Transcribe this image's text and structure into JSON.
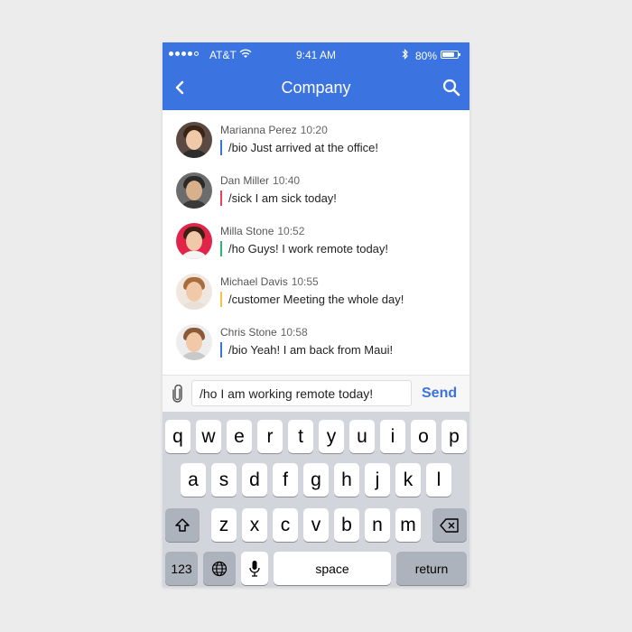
{
  "status_bar": {
    "carrier": "AT&T",
    "time": "9:41 AM",
    "battery": "80%"
  },
  "header": {
    "title": "Company",
    "back_icon": "chevron-left-icon",
    "search_icon": "search-icon"
  },
  "messages": [
    {
      "name": "Marianna Perez",
      "time": "10:20",
      "text": "/bio Just arrived at the office!",
      "accent": "#3b73e0"
    },
    {
      "name": "Dan Miller",
      "time": "10:40",
      "text": "/sick I am sick today!",
      "accent": "#e2445c"
    },
    {
      "name": "Milla Stone",
      "time": "10:52",
      "text": "/ho Guys! I work remote today!",
      "accent": "#2bb673"
    },
    {
      "name": "Michael Davis",
      "time": "10:55",
      "text": "/customer Meeting the whole day!",
      "accent": "#f4c542"
    },
    {
      "name": "Chris Stone",
      "time": "10:58",
      "text": "/bio Yeah! I am back from Maui!",
      "accent": "#3b73e0"
    }
  ],
  "composer": {
    "value": "/ho I am working remote today!",
    "send_label": "Send",
    "attach_icon": "paperclip-icon"
  },
  "keyboard": {
    "row1": [
      "q",
      "w",
      "e",
      "r",
      "t",
      "y",
      "u",
      "i",
      "o",
      "p"
    ],
    "row2": [
      "a",
      "s",
      "d",
      "f",
      "g",
      "h",
      "j",
      "k",
      "l"
    ],
    "row3": [
      "z",
      "x",
      "c",
      "v",
      "b",
      "n",
      "m"
    ],
    "numbers_label": "123",
    "space_label": "space",
    "return_label": "return",
    "shift_icon": "shift-icon",
    "backspace_icon": "backspace-icon",
    "globe_icon": "globe-icon",
    "mic_icon": "microphone-icon"
  },
  "colors": {
    "accent": "#3b73e0",
    "background": "#ececec",
    "keyboard": "#d2d5db"
  }
}
